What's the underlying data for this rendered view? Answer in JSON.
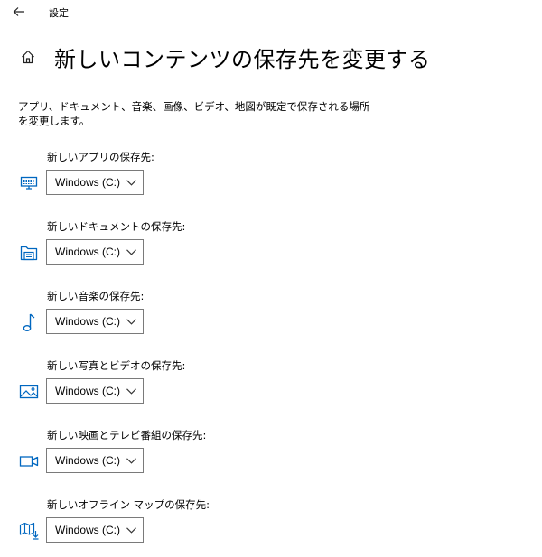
{
  "window": {
    "app_title": "設定"
  },
  "header": {
    "title": "新しいコンテンツの保存先を変更する"
  },
  "description": "アプリ、ドキュメント、音楽、画像、ビデオ、地図が既定で保存される場所を変更します。",
  "accent_color": "#0067c0",
  "settings": [
    {
      "label": "新しいアプリの保存先:",
      "icon": "monitor-icon",
      "value": "Windows (C:)"
    },
    {
      "label": "新しいドキュメントの保存先:",
      "icon": "documents-folder-icon",
      "value": "Windows (C:)"
    },
    {
      "label": "新しい音楽の保存先:",
      "icon": "music-note-icon",
      "value": "Windows (C:)"
    },
    {
      "label": "新しい写真とビデオの保存先:",
      "icon": "picture-icon",
      "value": "Windows (C:)"
    },
    {
      "label": "新しい映画とテレビ番組の保存先:",
      "icon": "video-camera-icon",
      "value": "Windows (C:)"
    },
    {
      "label": "新しいオフライン マップの保存先:",
      "icon": "offline-map-icon",
      "value": "Windows (C:)"
    }
  ]
}
